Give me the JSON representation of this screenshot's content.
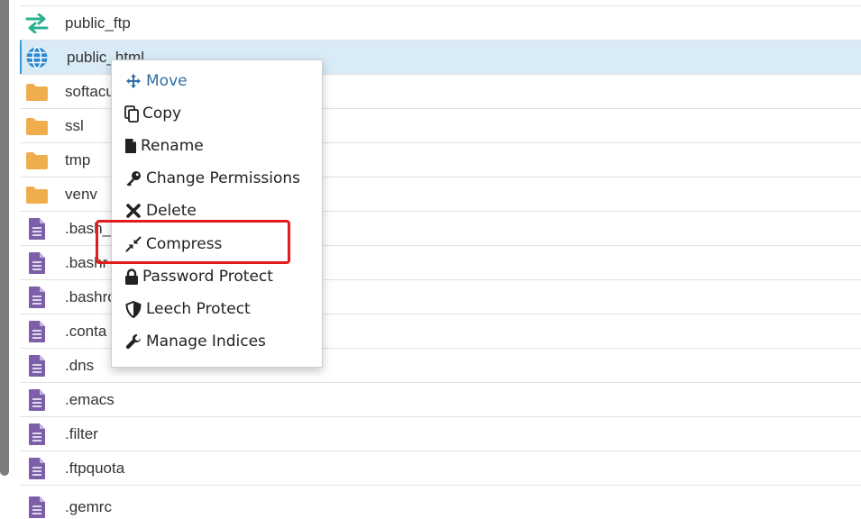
{
  "files": [
    {
      "name": "public_ftp",
      "icon": "transfer-arrows-icon",
      "selected": false
    },
    {
      "name": "public_html",
      "icon": "globe-icon",
      "selected": true
    },
    {
      "name": "softacu",
      "icon": "folder-icon",
      "selected": false
    },
    {
      "name": "ssl",
      "icon": "folder-icon",
      "selected": false
    },
    {
      "name": "tmp",
      "icon": "folder-icon",
      "selected": false
    },
    {
      "name": "venv",
      "icon": "folder-icon",
      "selected": false
    },
    {
      "name": ".bash_",
      "icon": "file-icon",
      "selected": false
    },
    {
      "name": ".bashr",
      "icon": "file-icon",
      "selected": false
    },
    {
      "name": ".bashrc",
      "icon": "file-icon",
      "selected": false
    },
    {
      "name": ".conta",
      "icon": "file-icon",
      "selected": false
    },
    {
      "name": ".dns",
      "icon": "file-icon",
      "selected": false
    },
    {
      "name": ".emacs",
      "icon": "file-icon",
      "selected": false
    },
    {
      "name": ".filter",
      "icon": "file-icon",
      "selected": false
    },
    {
      "name": ".ftpquota",
      "icon": "file-icon",
      "selected": false
    },
    {
      "name": ".gemrc",
      "icon": "file-icon",
      "selected": false
    }
  ],
  "context_menu": {
    "items": [
      {
        "label": "Move",
        "icon": "move-arrows-icon"
      },
      {
        "label": "Copy",
        "icon": "copy-icon"
      },
      {
        "label": "Rename",
        "icon": "file-rename-icon"
      },
      {
        "label": "Change Permissions",
        "icon": "key-icon"
      },
      {
        "label": "Delete",
        "icon": "x-delete-icon"
      },
      {
        "label": "Compress",
        "icon": "compress-arrows-icon"
      },
      {
        "label": "Password Protect",
        "icon": "lock-icon"
      },
      {
        "label": "Leech Protect",
        "icon": "shield-icon"
      },
      {
        "label": "Manage Indices",
        "icon": "wrench-icon"
      }
    ]
  },
  "colors": {
    "selected_row_bg": "#d8ebf7",
    "selected_row_border": "#3a9ad9",
    "folder": "#f0ad4e",
    "file": "#7e5ea8",
    "globe": "#2a8ad1",
    "transfer": "#2bb191",
    "menu_active": "#2c6ea6",
    "highlight": "#e31b1b"
  }
}
